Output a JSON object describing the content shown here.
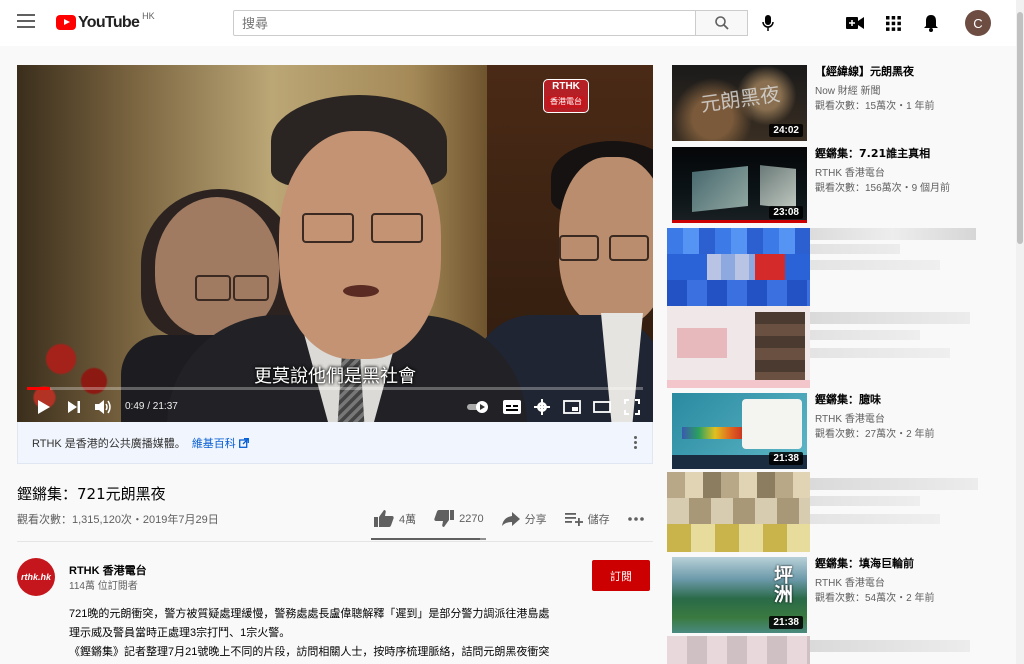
{
  "header": {
    "logo_text": "YouTube",
    "logo_region": "HK",
    "search_placeholder": "搜尋",
    "avatar_letter": "C"
  },
  "player": {
    "badge_top": "RTHK",
    "badge_bottom": "香港電台",
    "subtitle": "更莫說他們是黑社會",
    "time": "0:49 / 21:37",
    "progress": 0.038
  },
  "info_banner": {
    "text": "RTHK 是香港的公共廣播媒體。",
    "link": "維基百科"
  },
  "video": {
    "title": "鏗鏘集：721元朗黑夜",
    "meta": "觀看次數：1,315,120次・2019年7月29日",
    "likes": "4萬",
    "dislikes": "2270",
    "share": "分享",
    "save": "儲存",
    "like_ratio": 0.95
  },
  "channel": {
    "logo_text": "rthk.hk",
    "name": "RTHK 香港電台",
    "subscribers": "114萬 位訂閱者",
    "subscribe_label": "訂閱",
    "description_lines": [
      "721晚的元朗衝突，警方被質疑處理緩慢，警務處處長盧偉聰解釋「遲到」是部分警力調派往港島處",
      "理示威及警員當時正處理3宗打鬥、1宗火警。",
      "《鏗鏘集》記者整理7月21號晚上不同的片段，訪問相關人士，按時序梳理脈絡，詰問元朗黑夜衝突"
    ]
  },
  "recommendations": [
    {
      "title": "【經緯線】元朗黑夜",
      "channel": "Now 財經 新聞",
      "meta": "觀看次數：15萬次・1 年前",
      "duration": "24:02"
    },
    {
      "title": "鏗鏘集：7.21誰主真相",
      "channel": "RTHK 香港電台",
      "meta": "觀看次數：156萬次・9 個月前",
      "duration": "23:08"
    },
    {
      "title": "鏗鏘集：臆味",
      "channel": "RTHK 香港電台",
      "meta": "觀看次數：27萬次・2 年前",
      "duration": "21:38"
    },
    {
      "title": "鏗鏘集：填海巨輪前",
      "channel": "RTHK 香港電台",
      "meta": "觀看次數：54萬次・2 年前",
      "duration": "21:38"
    }
  ],
  "thumb4_overlay": "坪洲",
  "colors": {
    "brand_red": "#ff0000",
    "subscribe_red": "#cc0000",
    "link_blue": "#065fd4"
  }
}
